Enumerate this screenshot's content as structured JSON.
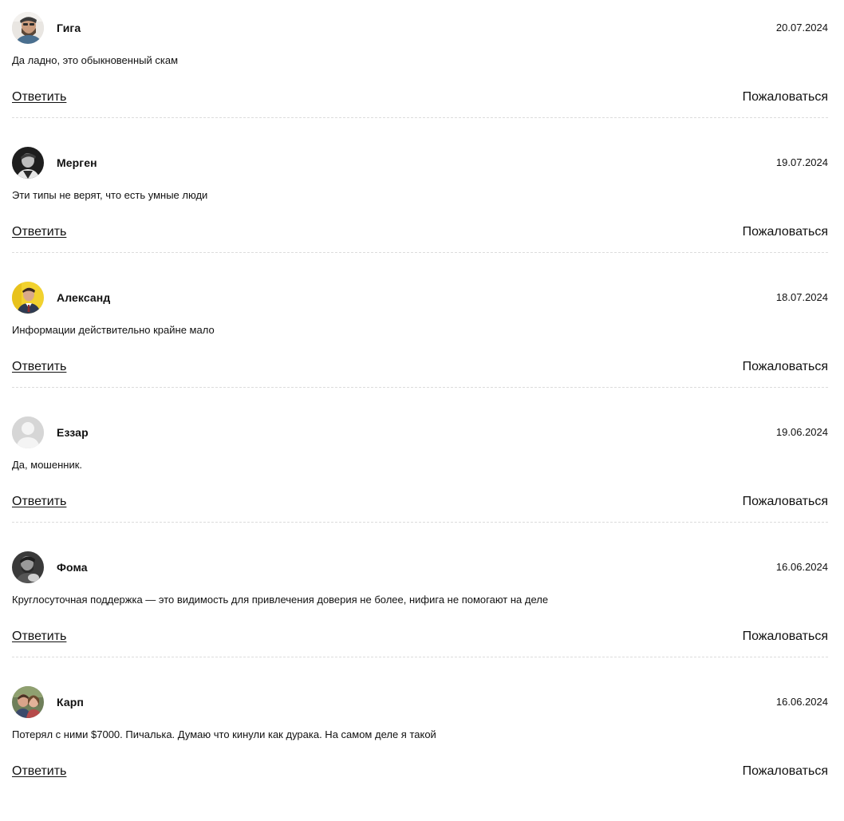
{
  "actions": {
    "reply_label": "Ответить",
    "complain_label": "Пожаловаться"
  },
  "comments": [
    {
      "author": "Гига",
      "date": "20.07.2024",
      "text": "Да ладно, это обыкновенный скам",
      "avatar": "photo-bearded-man-icon"
    },
    {
      "author": "Мерген",
      "date": "19.07.2024",
      "text": "Эти типы не верят, что есть умные люди",
      "avatar": "photo-man-dark-icon"
    },
    {
      "author": "Александ",
      "date": "18.07.2024",
      "text": "Информации действительно крайне мало",
      "avatar": "photo-man-suit-yellow-icon"
    },
    {
      "author": "Еззар",
      "date": "19.06.2024",
      "text": "Да, мошенник.",
      "avatar": "default-user-icon"
    },
    {
      "author": "Фома",
      "date": "16.06.2024",
      "text": "Круглосуточная поддержка — это видимость для привлечения доверия не более, нифига не помогают на деле",
      "avatar": "photo-man-guitar-icon"
    },
    {
      "author": "Карп",
      "date": "16.06.2024",
      "text": "Потерял с ними $7000. Пичалька. Думаю что кинули как дурака. На самом деле я такой",
      "avatar": "photo-couple-icon"
    }
  ]
}
